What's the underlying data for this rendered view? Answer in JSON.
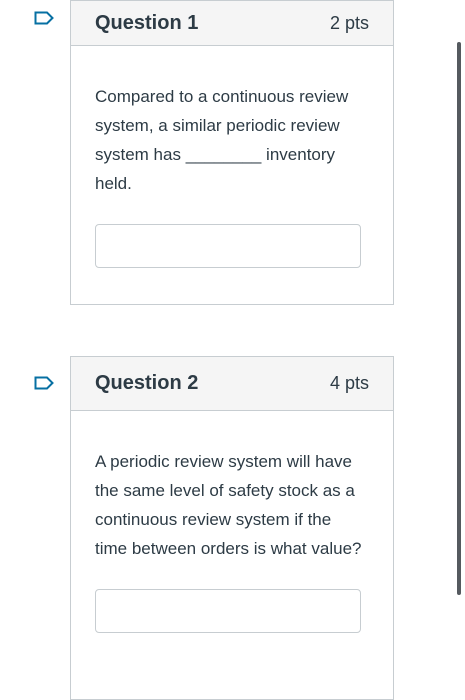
{
  "questions": [
    {
      "title": "Question 1",
      "points": "2 pts",
      "text": "Compared to a continuous review system, a similar periodic review system has ________ inventory held.",
      "answer_value": "",
      "answer_placeholder": ""
    },
    {
      "title": "Question 2",
      "points": "4 pts",
      "text": "A periodic review system will have the same level of safety stock as a continuous review system if the time between orders is what value?",
      "answer_value": "",
      "answer_placeholder": ""
    }
  ],
  "icons": {
    "flag": "flag-question-icon",
    "flag_color": "#0770a3"
  },
  "colors": {
    "border": "#c7cdd1",
    "header_bg": "#f5f5f5",
    "text": "#2d3b45"
  }
}
